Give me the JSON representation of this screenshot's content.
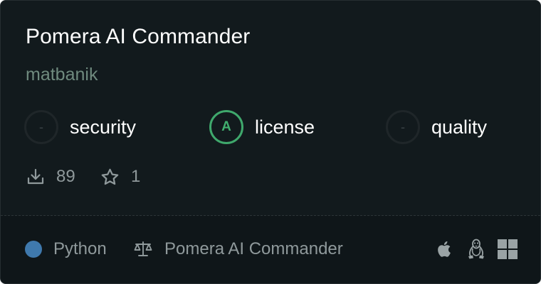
{
  "card": {
    "title": "Pomera AI Commander",
    "owner": "matbanik"
  },
  "metrics": [
    {
      "grade": "-",
      "label": "security"
    },
    {
      "grade": "A",
      "label": "license"
    },
    {
      "grade": "-",
      "label": "quality"
    }
  ],
  "stats": {
    "downloads": "89",
    "stars": "1"
  },
  "footer": {
    "language": "Python",
    "language_color": "#3f79ad",
    "license_name": "Pomera AI Commander",
    "platforms": [
      "apple-icon",
      "linux-icon",
      "windows-icon"
    ]
  },
  "colors": {
    "grade_a": "#41b06f",
    "background": "#121a1d"
  }
}
